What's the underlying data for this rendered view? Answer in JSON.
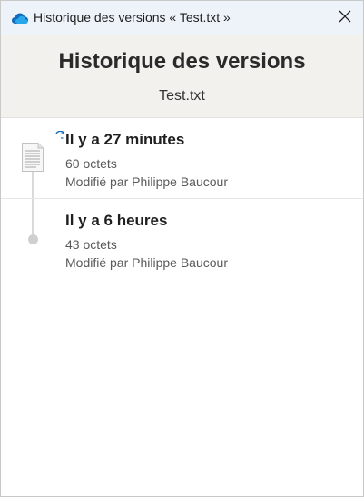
{
  "window": {
    "title": "Historique des versions « Test.txt »"
  },
  "header": {
    "title": "Historique des versions",
    "file_name": "Test.txt"
  },
  "versions": [
    {
      "time": "Il y a 27 minutes",
      "size": "60 octets",
      "author": "Modifié par Philippe Baucour",
      "icon": "text-document-icon"
    },
    {
      "time": "Il y a 6 heures",
      "size": "43 octets",
      "author": "Modifié par Philippe Baucour",
      "icon": "timeline-dot"
    }
  ],
  "colors": {
    "titlebar": "#eef3fa",
    "header": "#f3f1ee",
    "onedrive_blue": "#0f6cbd"
  }
}
